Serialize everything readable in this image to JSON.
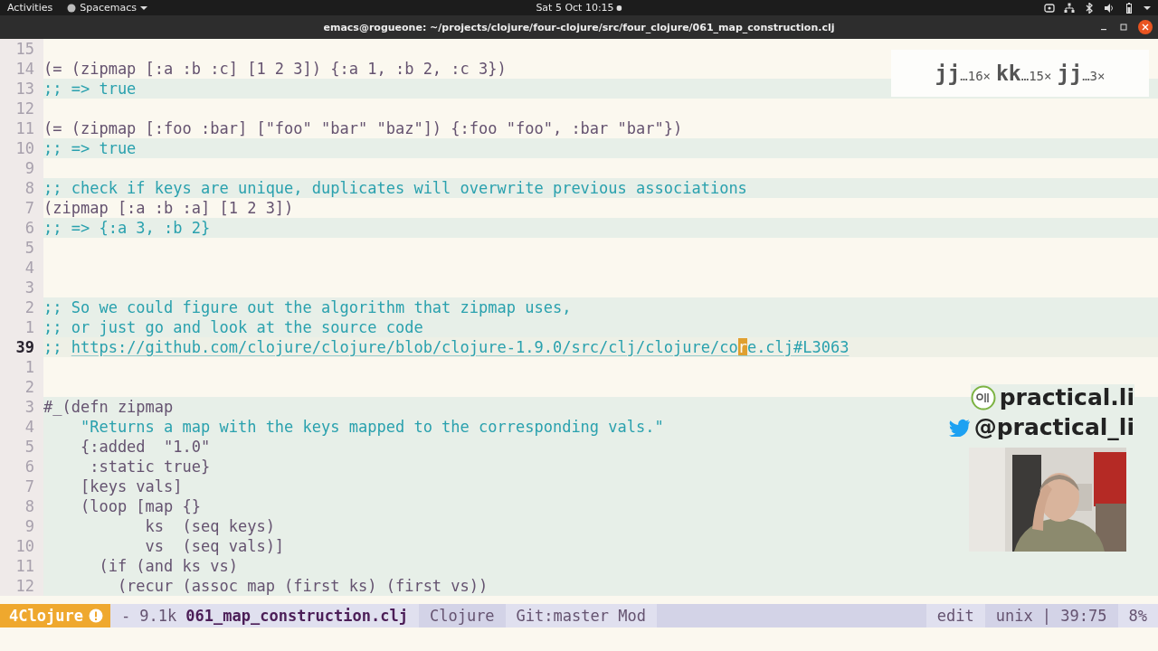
{
  "top_bar": {
    "activities": "Activities",
    "app_menu": "Spacemacs",
    "clock": "Sat 5 Oct  10:15"
  },
  "window": {
    "title": "emacs@rogueone: ~/projects/clojure/four-clojure/src/four_clojure/061_map_construction.clj"
  },
  "editor": {
    "lines": [
      {
        "number": "15",
        "kind": "code",
        "highlighted": false,
        "current": false
      },
      {
        "number": "14",
        "text": "(= (zipmap [:a :b :c] [1 2 3]) {:a 1, :b 2, :c 3})",
        "kind": "code",
        "highlighted": false,
        "current": false
      },
      {
        "number": "13",
        "text": ";; => true",
        "kind": "comment",
        "highlighted": true,
        "current": false
      },
      {
        "number": "12",
        "kind": "code",
        "highlighted": false,
        "current": false
      },
      {
        "number": "11",
        "text": "(= (zipmap [:foo :bar] [\"foo\" \"bar\" \"baz\"]) {:foo \"foo\", :bar \"bar\"})",
        "kind": "code",
        "highlighted": false,
        "current": false
      },
      {
        "number": "10",
        "text": ";; => true",
        "kind": "comment",
        "highlighted": true,
        "current": false
      },
      {
        "number": "9",
        "kind": "code",
        "highlighted": false,
        "current": false
      },
      {
        "number": "8",
        "text": ";; check if keys are unique, duplicates will overwrite previous associations",
        "kind": "comment",
        "highlighted": true,
        "current": false
      },
      {
        "number": "7",
        "text": "(zipmap [:a :b :a] [1 2 3])",
        "kind": "code",
        "highlighted": false,
        "current": false
      },
      {
        "number": "6",
        "text": ";; => {:a 3, :b 2}",
        "kind": "comment",
        "highlighted": true,
        "current": false
      },
      {
        "number": "5",
        "kind": "code",
        "highlighted": false,
        "current": false
      },
      {
        "number": "4",
        "kind": "code",
        "highlighted": false,
        "current": false
      },
      {
        "number": "3",
        "kind": "code",
        "highlighted": false,
        "current": false
      },
      {
        "number": "2",
        "text": ";; So we could figure out the algorithm that zipmap uses,",
        "kind": "comment",
        "highlighted": true,
        "current": false
      },
      {
        "number": "1",
        "text": ";; or just go and look at the source code",
        "kind": "comment",
        "highlighted": true,
        "current": false
      },
      {
        "number": "39",
        "text": ";; ",
        "kind": "link",
        "link_before": "https://github.com/clojure/clojure/blob/clojure-1.9.0/src/clj/clojure/co",
        "cursor_char": "r",
        "link_after": "e.clj#L3063",
        "highlighted": true,
        "current": true
      },
      {
        "number": "1",
        "kind": "code",
        "highlighted": false,
        "current": false
      },
      {
        "number": "2",
        "kind": "code",
        "highlighted": false,
        "current": false
      },
      {
        "number": "3",
        "text": "#_(defn zipmap",
        "kind": "code",
        "highlighted": true,
        "current": false
      },
      {
        "number": "4",
        "text": "    \"Returns a map with the keys mapped to the corresponding vals.\"",
        "kind": "string",
        "highlighted": true,
        "current": false
      },
      {
        "number": "5",
        "text": "    {:added  \"1.0\"",
        "kind": "code",
        "highlighted": true,
        "current": false
      },
      {
        "number": "6",
        "text": "     :static true}",
        "kind": "code",
        "highlighted": true,
        "current": false
      },
      {
        "number": "7",
        "text": "    [keys vals]",
        "kind": "code",
        "highlighted": true,
        "current": false
      },
      {
        "number": "8",
        "text": "    (loop [map {}",
        "kind": "code",
        "highlighted": true,
        "current": false
      },
      {
        "number": "9",
        "text": "           ks  (seq keys)",
        "kind": "code",
        "highlighted": true,
        "current": false
      },
      {
        "number": "10",
        "text": "           vs  (seq vals)]",
        "kind": "code",
        "highlighted": true,
        "current": false
      },
      {
        "number": "11",
        "text": "      (if (and ks vs)",
        "kind": "code",
        "highlighted": true,
        "current": false
      },
      {
        "number": "12",
        "text": "        (recur (assoc map (first ks) (first vs))",
        "kind": "code",
        "highlighted": true,
        "current": false
      }
    ]
  },
  "keycast": [
    {
      "keys": "jj",
      "count": "…16×"
    },
    {
      "keys": "kk",
      "count": "…15×"
    },
    {
      "keys": "jj",
      "count": "…3×"
    }
  ],
  "branding": {
    "site": "practical.li",
    "handle": "@practical_li"
  },
  "status_bar": {
    "workspace": "4Clojure",
    "size": "- 9.1k",
    "filename": "061_map_construction.clj",
    "mode": "Clojure",
    "vcs": "Git:master Mod",
    "state": "edit",
    "position": "unix | 39:75",
    "percent": "8%"
  }
}
